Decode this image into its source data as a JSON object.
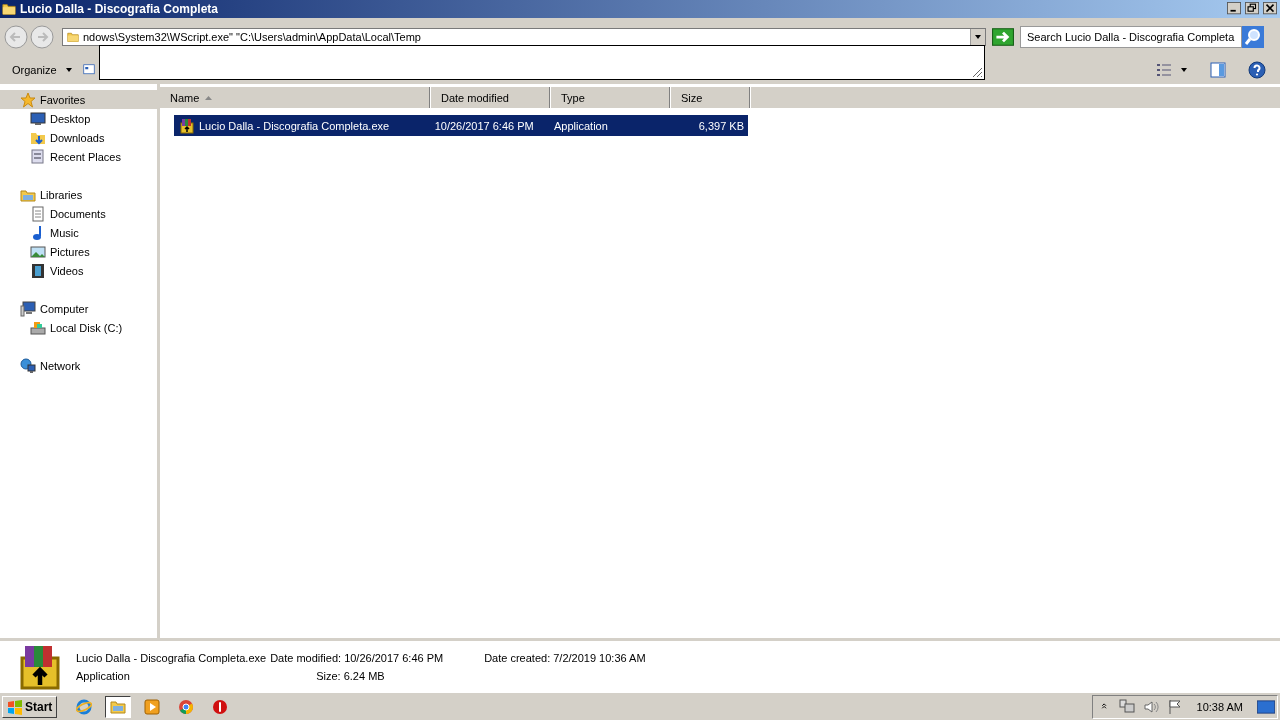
{
  "window": {
    "title": "Lucio Dalla - Discografia Completa"
  },
  "address": {
    "value": "ndows\\System32\\WScript.exe\" \"C:\\Users\\admin\\AppData\\Local\\Temp"
  },
  "search": {
    "placeholder": "Search Lucio Dalla - Discografia Completa"
  },
  "toolbar": {
    "organize": "Organize"
  },
  "sidebar": {
    "groups": [
      {
        "label": "Favorites",
        "kind": "star",
        "selected": true,
        "children": [
          {
            "label": "Desktop",
            "kind": "desktop",
            "selected": false
          },
          {
            "label": "Downloads",
            "kind": "downloads",
            "selected": false
          },
          {
            "label": "Recent Places",
            "kind": "recent",
            "selected": false
          }
        ]
      },
      {
        "label": "Libraries",
        "kind": "libraries",
        "selected": false,
        "children": [
          {
            "label": "Documents",
            "kind": "documents",
            "selected": false
          },
          {
            "label": "Music",
            "kind": "music",
            "selected": false
          },
          {
            "label": "Pictures",
            "kind": "pictures",
            "selected": false
          },
          {
            "label": "Videos",
            "kind": "videos",
            "selected": false
          }
        ]
      },
      {
        "label": "Computer",
        "kind": "computer",
        "selected": false,
        "children": [
          {
            "label": "Local Disk (C:)",
            "kind": "disk",
            "selected": false
          }
        ]
      },
      {
        "label": "Network",
        "kind": "network",
        "selected": false
      }
    ]
  },
  "table": {
    "columns": [
      {
        "label": "Name",
        "sorted": true
      },
      {
        "label": "Date modified",
        "sorted": false
      },
      {
        "label": "Type",
        "sorted": false
      },
      {
        "label": "Size",
        "sorted": false
      }
    ],
    "rows": [
      {
        "cells": [
          "Lucio Dalla - Discografia Completa.exe",
          "10/26/2017 6:46 PM",
          "Application",
          "6,397 KB"
        ],
        "selected": true
      }
    ]
  },
  "details": {
    "name": "Lucio Dalla - Discografia Completa.exe",
    "type": "Application",
    "date_modified_label": "Date modified:",
    "date_modified": "10/26/2017 6:46 PM",
    "date_created_label": "Date created:",
    "date_created": "7/2/2019 10:36 AM",
    "size_label": "Size:",
    "size": "6.24 MB"
  },
  "taskbar": {
    "start": "Start",
    "apps": [
      {
        "kind": "ie",
        "selected": false
      },
      {
        "kind": "explorer",
        "selected": true
      },
      {
        "kind": "media",
        "selected": false
      },
      {
        "kind": "chrome",
        "selected": false
      },
      {
        "kind": "stop",
        "selected": false
      }
    ],
    "clock": "10:38 AM"
  }
}
